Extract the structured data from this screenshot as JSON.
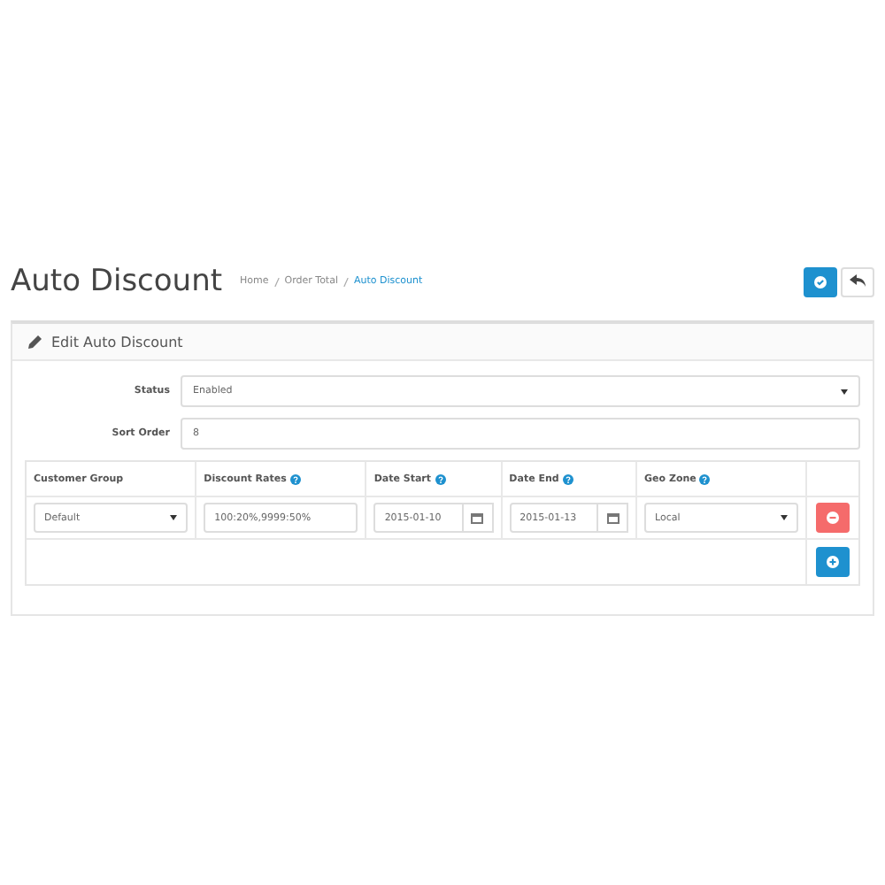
{
  "header": {
    "title": "Auto Discount",
    "breadcrumb": [
      {
        "label": "Home",
        "selected": false
      },
      {
        "label": "Order Total",
        "selected": false
      },
      {
        "label": "Auto Discount",
        "selected": true
      }
    ]
  },
  "panel": {
    "title": "Edit Auto Discount",
    "form": [
      {
        "label": "Status",
        "kind": "select",
        "value": "Enabled"
      },
      {
        "label": "Sort Order",
        "kind": "input",
        "value": "8"
      }
    ],
    "table": {
      "columns": [
        {
          "label": "Customer Group",
          "help": false
        },
        {
          "label": "Discount Rates",
          "help": true
        },
        {
          "label": "Date Start",
          "help": true
        },
        {
          "label": "Date End",
          "help": true
        },
        {
          "label": "Geo Zone",
          "help": true
        }
      ],
      "rows": [
        [
          {
            "kind": "select",
            "value": "Default"
          },
          {
            "kind": "input",
            "value": "100:20%,9999:50%"
          },
          {
            "kind": "date",
            "value": "2015-01-10"
          },
          {
            "kind": "date",
            "value": "2015-01-13"
          },
          {
            "kind": "select",
            "value": "Local"
          }
        ]
      ]
    }
  }
}
